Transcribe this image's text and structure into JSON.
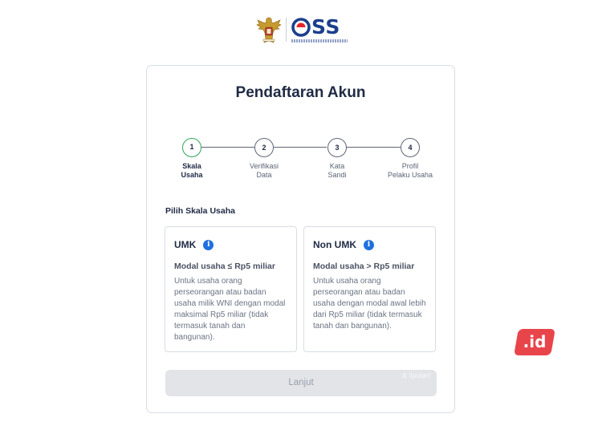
{
  "header": {
    "logo_text": "OSS",
    "logo_subtitle": "KEMENTERIAN INVESTASI/BADAN KOORDINASI PENANAMAN MODAL"
  },
  "card": {
    "title": "Pendaftaran Akun"
  },
  "stepper": {
    "steps": [
      {
        "number": "1",
        "label": "Skala\nUsaha",
        "active": true
      },
      {
        "number": "2",
        "label": "Verifikasi\nData",
        "active": false
      },
      {
        "number": "3",
        "label": "Kata\nSandi",
        "active": false
      },
      {
        "number": "4",
        "label": "Profil\nPelaku Usaha",
        "active": false
      }
    ]
  },
  "scale": {
    "section_label": "Pilih Skala Usaha",
    "options": [
      {
        "title": "UMK",
        "info_icon": "info-icon",
        "subtitle": "Modal usaha ≤ Rp5 miliar",
        "description": "Untuk usaha orang perseorangan atau badan usaha milik WNI dengan modal maksimal Rp5 miliar (tidak termasuk tanah dan bangunan)."
      },
      {
        "title": "Non UMK",
        "info_icon": "info-icon",
        "subtitle": "Modal usaha > Rp5 miliar",
        "description": "Untuk usaha orang perseorangan atau badan usaha dengan modal awal lebih dari Rp5 miliar (tidak termasuk tanah dan bangunan)."
      }
    ]
  },
  "actions": {
    "next_label": "Lanjut"
  },
  "watermark": {
    "badge_text": ".id",
    "faint_text": "& liputan"
  },
  "colors": {
    "primary_text": "#1f2a44",
    "active_step": "#2fa35a",
    "info_icon": "#1f6fe0",
    "button_disabled_bg": "#e2e4e8",
    "watermark_red": "#e8454b",
    "brand_blue": "#1c3f8c"
  }
}
